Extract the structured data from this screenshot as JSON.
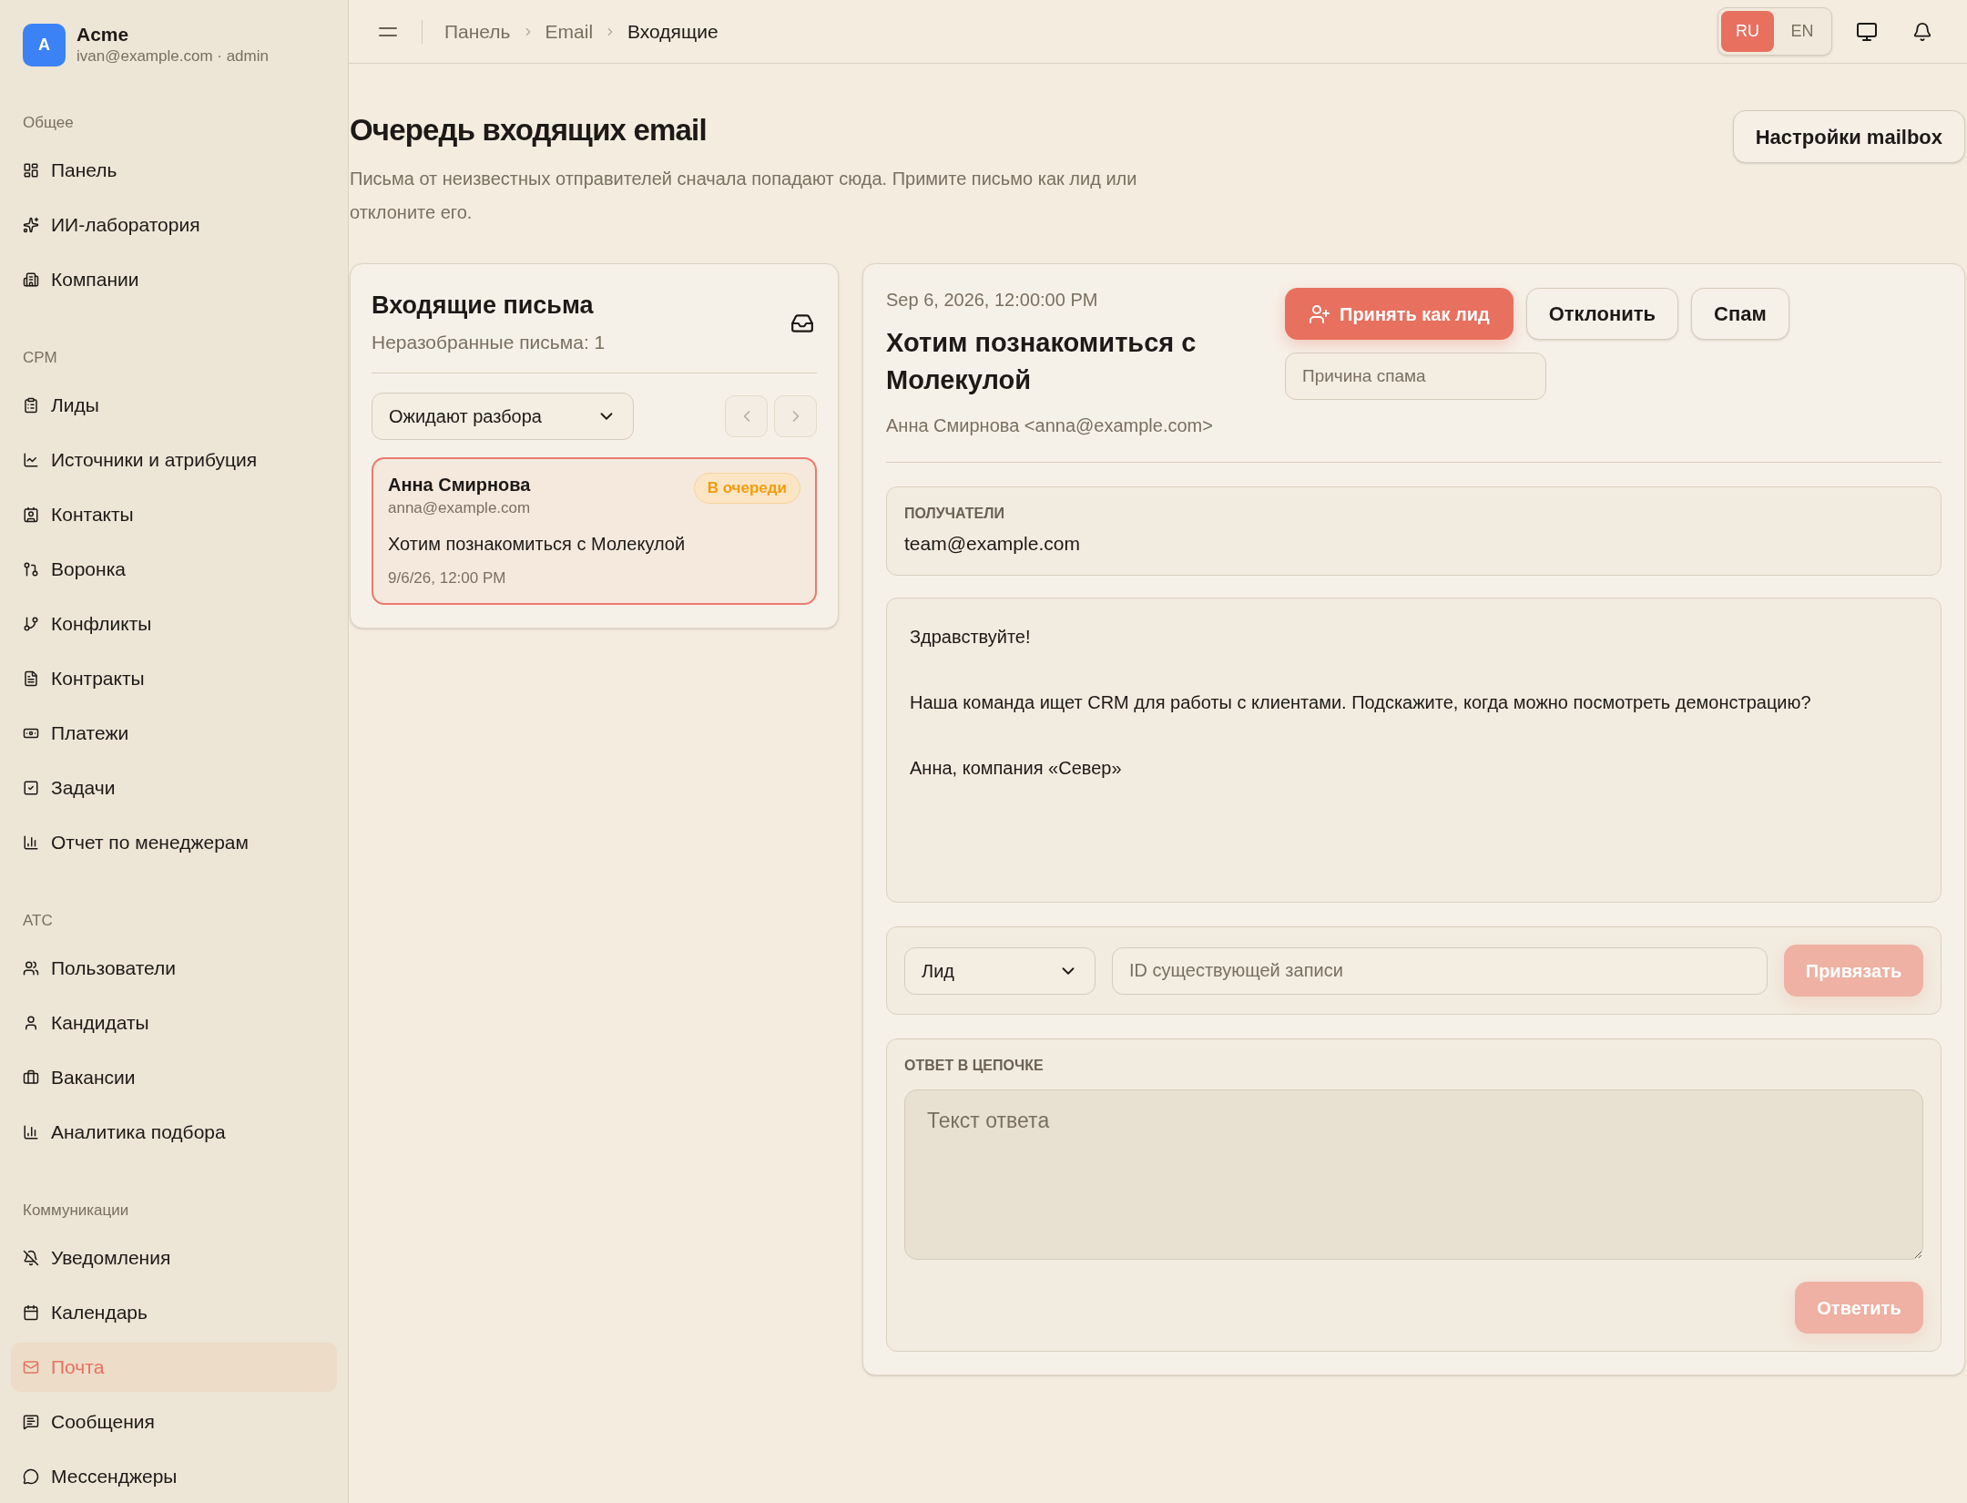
{
  "sidebar": {
    "brand": {
      "initial": "A",
      "name": "Acme",
      "subtitle": "ivan@example.com · admin"
    },
    "sections": [
      {
        "title": "Общее",
        "items": [
          {
            "label": "Панель",
            "selected": false
          },
          {
            "label": "ИИ-лаборатория",
            "selected": false
          },
          {
            "label": "Компании",
            "selected": false
          }
        ]
      },
      {
        "title": "CPM",
        "items": [
          {
            "label": "Лиды",
            "selected": false
          },
          {
            "label": "Источники и атрибуция",
            "selected": false
          },
          {
            "label": "Контакты",
            "selected": false
          },
          {
            "label": "Воронка",
            "selected": false
          },
          {
            "label": "Конфликты",
            "selected": false
          },
          {
            "label": "Контракты",
            "selected": false
          },
          {
            "label": "Платежи",
            "selected": false
          },
          {
            "label": "Задачи",
            "selected": false
          },
          {
            "label": "Отчет по менеджерам",
            "selected": false
          }
        ]
      },
      {
        "title": "ATC",
        "items": [
          {
            "label": "Пользователи",
            "selected": false
          },
          {
            "label": "Кандидаты",
            "selected": false
          },
          {
            "label": "Вакансии",
            "selected": false
          },
          {
            "label": "Аналитика подбора",
            "selected": false
          }
        ]
      },
      {
        "title": "Коммуникации",
        "items": [
          {
            "label": "Уведомления",
            "selected": false
          },
          {
            "label": "Календарь",
            "selected": false
          },
          {
            "label": "Почта",
            "selected": true
          },
          {
            "label": "Сообщения",
            "selected": false
          },
          {
            "label": "Мессенджеры",
            "selected": false
          }
        ]
      }
    ]
  },
  "header": {
    "breadcrumbs": [
      {
        "label": "Панель",
        "current": false
      },
      {
        "label": "Email",
        "current": false
      },
      {
        "label": "Входящие",
        "current": true
      }
    ],
    "languages": [
      {
        "label": "RU",
        "selected": true
      },
      {
        "label": "EN",
        "selected": false
      }
    ]
  },
  "page": {
    "title": "Очередь входящих email",
    "description": "Письма от неизвестных отправителей сначала попадают сюда. Примите письмо как лид или отклоните его.",
    "settings_button": "Настройки mailbox"
  },
  "inbox": {
    "title": "Входящие письма",
    "count": "Неразобранные письма: 1",
    "filter": "Ожидают разбора",
    "pager": [
      {
        "kind": "previous",
        "disabled": true
      },
      {
        "kind": "next",
        "disabled": true
      }
    ],
    "messages": [
      {
        "sender": "Анна Смирнова",
        "email": "anna@example.com",
        "subject": "Хотим познакомиться с Молекулой",
        "date": "9/6/26, 12:00 PM",
        "status": "В очереди",
        "selected": true
      }
    ]
  },
  "detail": {
    "date": "Sep 6, 2026, 12:00:00 PM",
    "subject": "Хотим познакомиться с Молекулой",
    "from": "Анна Смирнова <anna@example.com>",
    "actions": [
      {
        "label": "Принять как лид",
        "kind": "primary"
      },
      {
        "label": "Отклонить",
        "kind": "outline"
      },
      {
        "label": "Спам",
        "kind": "outline"
      }
    ],
    "spam_reason": {
      "placeholder": "Причина спама"
    },
    "recipients": {
      "label": "ПОЛУЧАТЕЛИ",
      "value": "team@example.com"
    },
    "body": [
      "Здравствуйте!",
      "Наша команда ищет CRM для работы с клиентами. Подскажите, когда можно посмотреть демонстрацию?",
      "Анна, компания «Север»"
    ],
    "link": {
      "type": "Лид",
      "record_id": {
        "placeholder": "ID существующей записи"
      },
      "button": {
        "label": "Привязать",
        "disabled": true
      }
    },
    "reply": {
      "label": "ОТВЕТ В ЦЕПОЧКЕ",
      "placeholder": "Текст ответа",
      "button": {
        "label": "Ответить",
        "disabled": true
      }
    }
  }
}
